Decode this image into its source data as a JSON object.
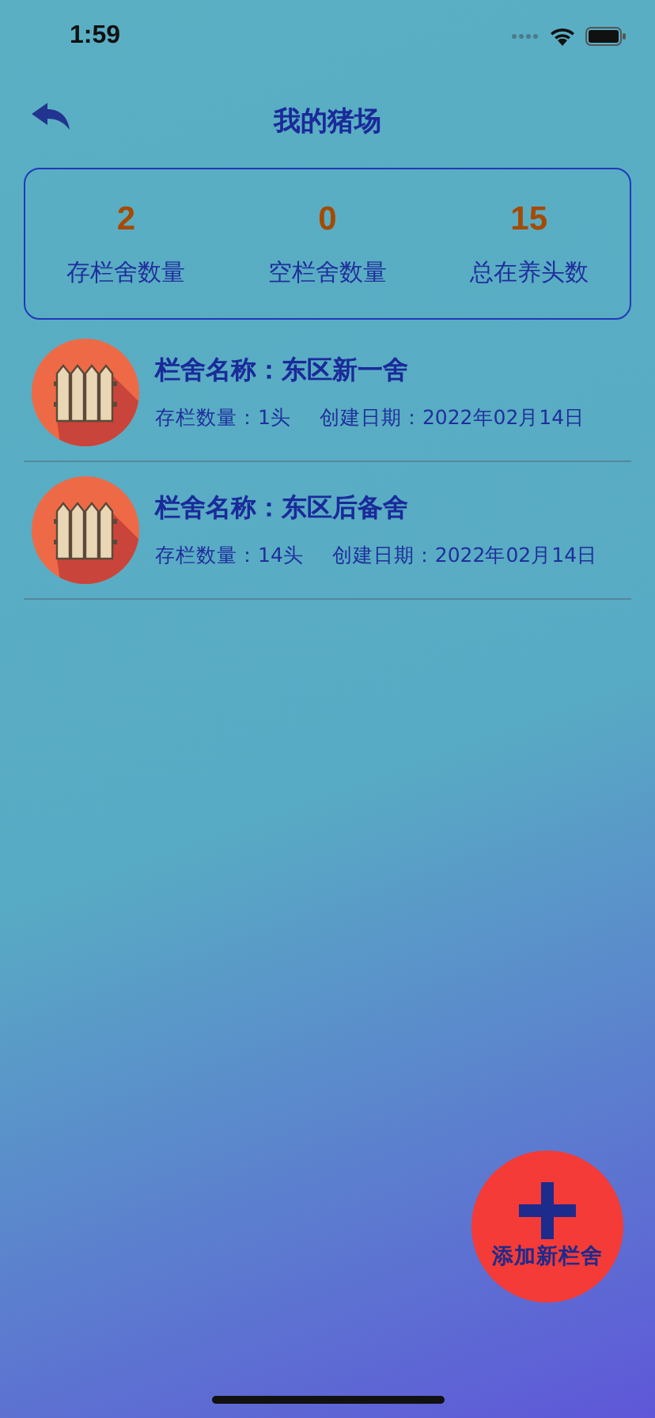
{
  "status_bar": {
    "time": "1:59"
  },
  "header": {
    "title": "我的猪场"
  },
  "stats": [
    {
      "value": "2",
      "label": "存栏舍数量"
    },
    {
      "value": "0",
      "label": "空栏舍数量"
    },
    {
      "value": "15",
      "label": "总在养头数"
    }
  ],
  "pens": [
    {
      "name": "栏舍名称：东区新一舍",
      "count": "存栏数量：1头",
      "date": "创建日期：2022年02月14日"
    },
    {
      "name": "栏舍名称：东区后备舍",
      "count": "存栏数量：14头",
      "date": "创建日期：2022年02月14日"
    }
  ],
  "add_button": {
    "label": "添加新栏舍"
  }
}
